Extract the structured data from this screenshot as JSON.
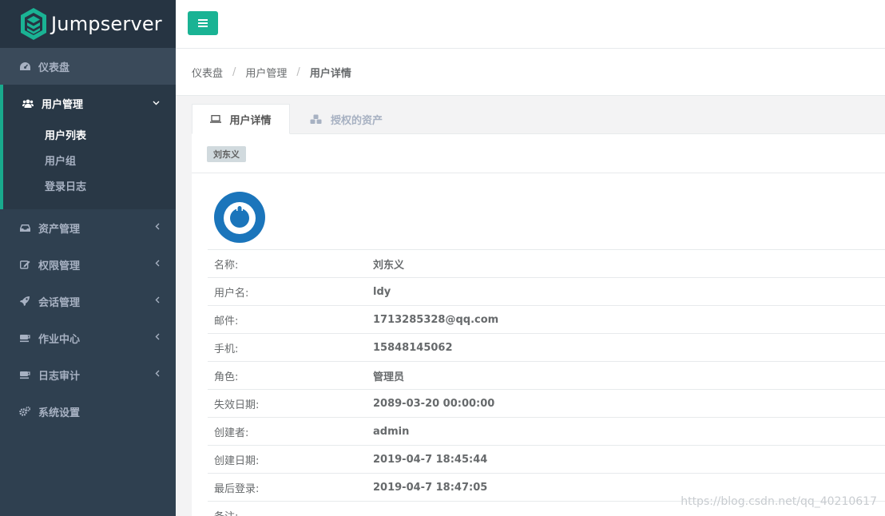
{
  "app": {
    "title": "Jumpserver"
  },
  "sidebar": {
    "items": [
      {
        "label": "仪表盘",
        "icon": "dashboard-icon"
      },
      {
        "label": "用户管理",
        "icon": "users-icon",
        "expanded": true,
        "children": [
          {
            "label": "用户列表",
            "selected": true
          },
          {
            "label": "用户组"
          },
          {
            "label": "登录日志"
          }
        ]
      },
      {
        "label": "资产管理",
        "icon": "inbox-icon"
      },
      {
        "label": "权限管理",
        "icon": "edit-icon"
      },
      {
        "label": "会话管理",
        "icon": "rocket-icon"
      },
      {
        "label": "作业中心",
        "icon": "coffee-icon"
      },
      {
        "label": "日志审计",
        "icon": "coffee-icon"
      },
      {
        "label": "系统设置",
        "icon": "gears-icon"
      }
    ]
  },
  "breadcrumb": [
    "仪表盘",
    "用户管理",
    "用户详情"
  ],
  "tabs": [
    {
      "label": "用户详情",
      "icon": "laptop-icon",
      "active": true
    },
    {
      "label": "授权的资产",
      "icon": "cubes-icon",
      "active": false
    }
  ],
  "user": {
    "badge": "刘东义",
    "fields": [
      {
        "label": "名称:",
        "value": "刘东义"
      },
      {
        "label": "用户名:",
        "value": "ldy"
      },
      {
        "label": "邮件:",
        "value": "1713285328@qq.com"
      },
      {
        "label": "手机:",
        "value": "15848145062"
      },
      {
        "label": "角色:",
        "value": "管理员"
      },
      {
        "label": "失效日期:",
        "value": "2089-03-20 00:00:00"
      },
      {
        "label": "创建者:",
        "value": "admin"
      },
      {
        "label": "创建日期:",
        "value": "2019-04-7 18:45:44"
      },
      {
        "label": "最后登录:",
        "value": "2019-04-7 18:47:05"
      },
      {
        "label": "备注:",
        "value": ""
      }
    ]
  },
  "watermark": "https://blog.csdn.net/qq_40210617",
  "colors": {
    "sidebar_bg": "#2f4050",
    "accent": "#1ab394",
    "avatar_blue": "#1b75bb"
  }
}
